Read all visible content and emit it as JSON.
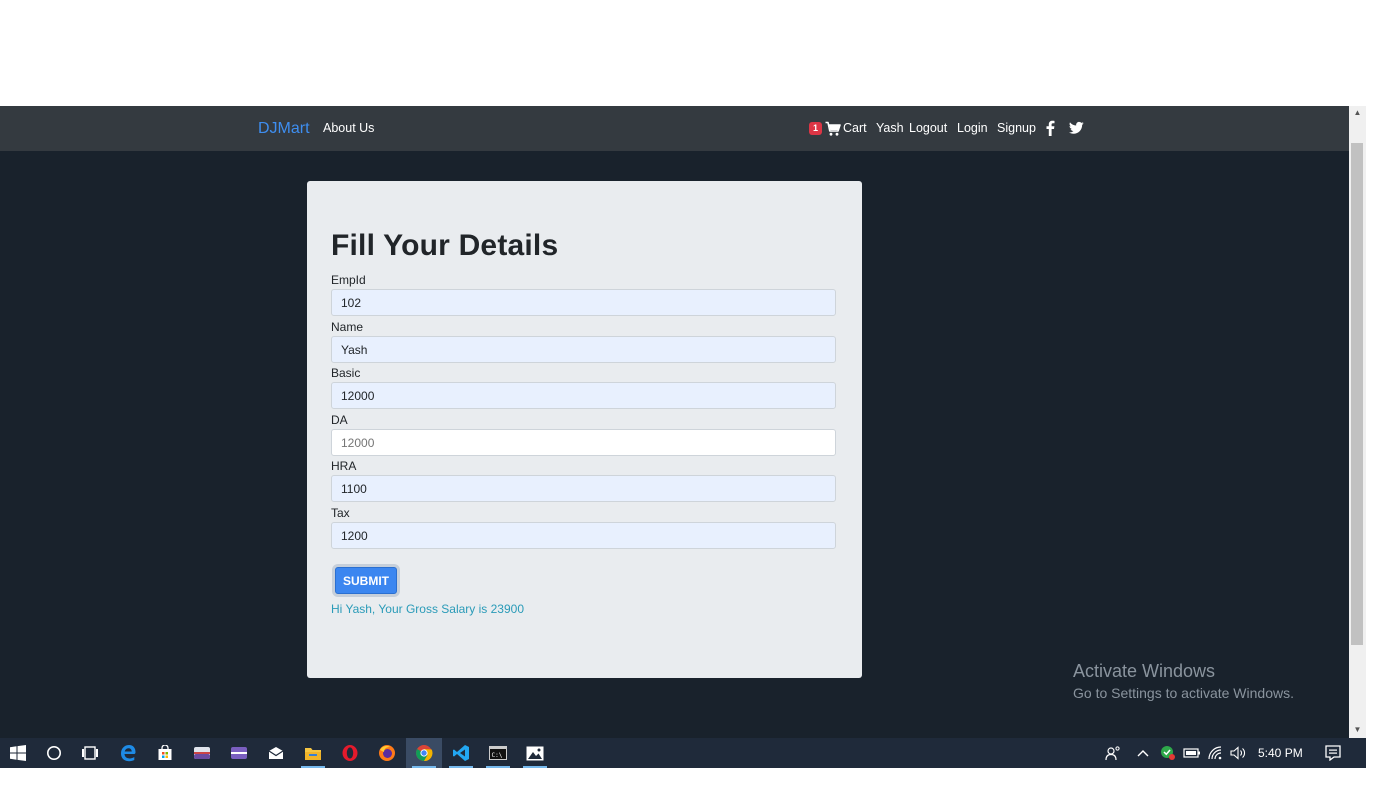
{
  "navbar": {
    "brand": "DJMart",
    "about": "About Us",
    "cart_count": "1",
    "cart": "Cart",
    "user": "Yash",
    "logout": "Logout",
    "login": "Login",
    "signup": "Signup",
    "icons": [
      "cart-icon",
      "facebook-icon",
      "twitter-icon"
    ]
  },
  "form": {
    "title": "Fill Your Details",
    "fields": [
      {
        "label": "EmpId",
        "value": "102"
      },
      {
        "label": "Name",
        "value": "Yash"
      },
      {
        "label": "Basic",
        "value": "12000"
      },
      {
        "label": "DA",
        "placeholder": "12000"
      },
      {
        "label": "HRA",
        "value": "1100"
      },
      {
        "label": "Tax",
        "value": "1200"
      }
    ],
    "submit": "SUBMIT",
    "result": "Hi Yash, Your Gross Salary is 23900"
  },
  "watermark": {
    "title": "Activate Windows",
    "subtitle": "Go to Settings to activate Windows."
  },
  "taskbar": {
    "apps": [
      "windows-start-icon",
      "cortana-icon",
      "task-view-icon",
      "edge-icon",
      "store-icon",
      "app-icon",
      "app-icon",
      "mail-icon",
      "file-explorer-icon",
      "opera-icon",
      "firefox-icon",
      "chrome-icon",
      "vscode-icon",
      "terminal-icon",
      "photos-icon"
    ],
    "clock": "5:40 PM"
  },
  "colors": {
    "navbar": "#343a40",
    "page_background": "#19222c",
    "brand": "#3e8ef0",
    "submit": "#3b86f0",
    "result_text": "#2a9bb8",
    "badge": "#dc3545"
  }
}
